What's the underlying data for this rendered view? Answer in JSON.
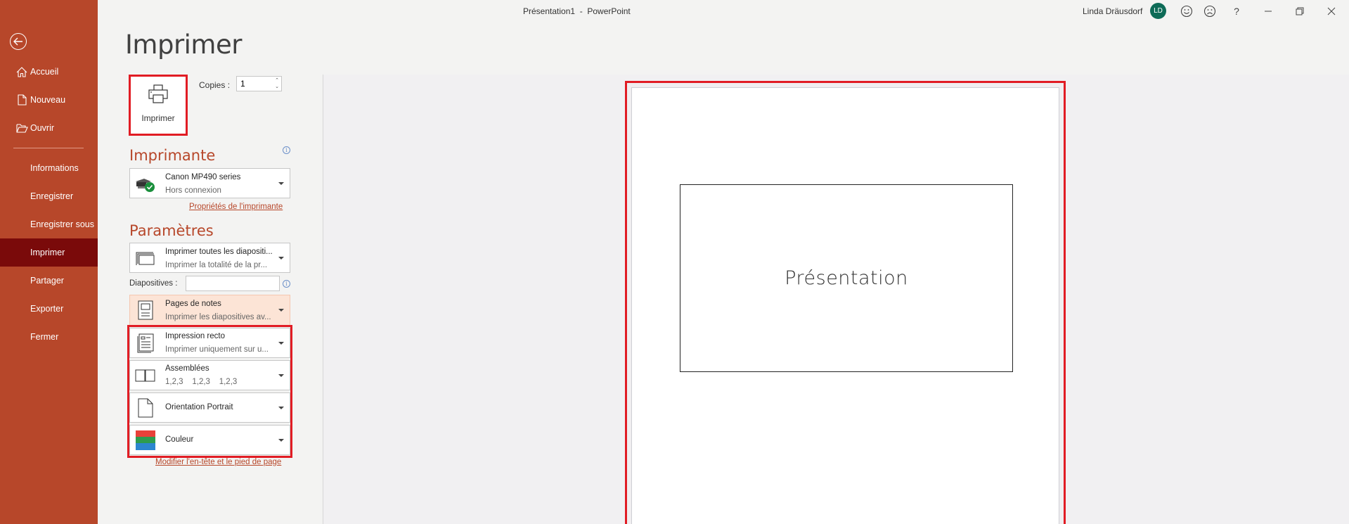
{
  "window": {
    "title": "Présentation1  -  PowerPoint",
    "user_name": "Linda Dräusdorf",
    "user_initials": "LD",
    "controls": [
      "smile-icon",
      "frown-icon",
      "help-icon",
      "minimize-icon",
      "restore-icon",
      "close-icon"
    ],
    "help_glyph": "?"
  },
  "sidebar": {
    "back": "back-icon",
    "items": [
      {
        "label": "Accueil",
        "icon": "home-icon"
      },
      {
        "label": "Nouveau",
        "icon": "new-document-icon"
      },
      {
        "label": "Ouvrir",
        "icon": "open-folder-icon"
      },
      {
        "label": "Informations"
      },
      {
        "label": "Enregistrer"
      },
      {
        "label": "Enregistrer sous"
      },
      {
        "label": "Imprimer",
        "active": true
      },
      {
        "label": "Partager"
      },
      {
        "label": "Exporter"
      },
      {
        "label": "Fermer"
      }
    ]
  },
  "print": {
    "page_title": "Imprimer",
    "print_button_label": "Imprimer",
    "copies_label": "Copies :",
    "copies_value": "1",
    "printer_section": "Imprimante",
    "printer": {
      "name": "Canon MP490 series",
      "status": "Hors connexion"
    },
    "printer_properties_link": "Propriétés de l'imprimante",
    "settings_section": "Paramètres",
    "settings": [
      {
        "line1": "Imprimer toutes les diapositi...",
        "line2": "Imprimer la totalité de la pr...",
        "icon": "all-slides-icon"
      },
      {
        "line1": "Pages de notes",
        "line2": "Imprimer les diapositives av...",
        "icon": "notes-pages-icon"
      },
      {
        "line1": "Impression recto",
        "line2": "Imprimer uniquement sur u...",
        "icon": "one-sided-icon"
      },
      {
        "line1": "Assemblées",
        "line2": "1,2,3    1,2,3    1,2,3",
        "icon": "collated-icon"
      },
      {
        "line1": "Orientation Portrait",
        "icon": "portrait-icon"
      },
      {
        "line1": "Couleur",
        "icon": "color-icon"
      }
    ],
    "slides_label": "Diapositives :",
    "slides_value": "",
    "header_footer_link": "Modifier l'en-tête et le pied de page"
  },
  "preview": {
    "slide_title": "Présentation"
  },
  "colors": {
    "accent": "#b7472a",
    "active_sidebar": "#7a0a0a",
    "highlight_box": "#e11c24",
    "avatar": "#0e6b57"
  }
}
